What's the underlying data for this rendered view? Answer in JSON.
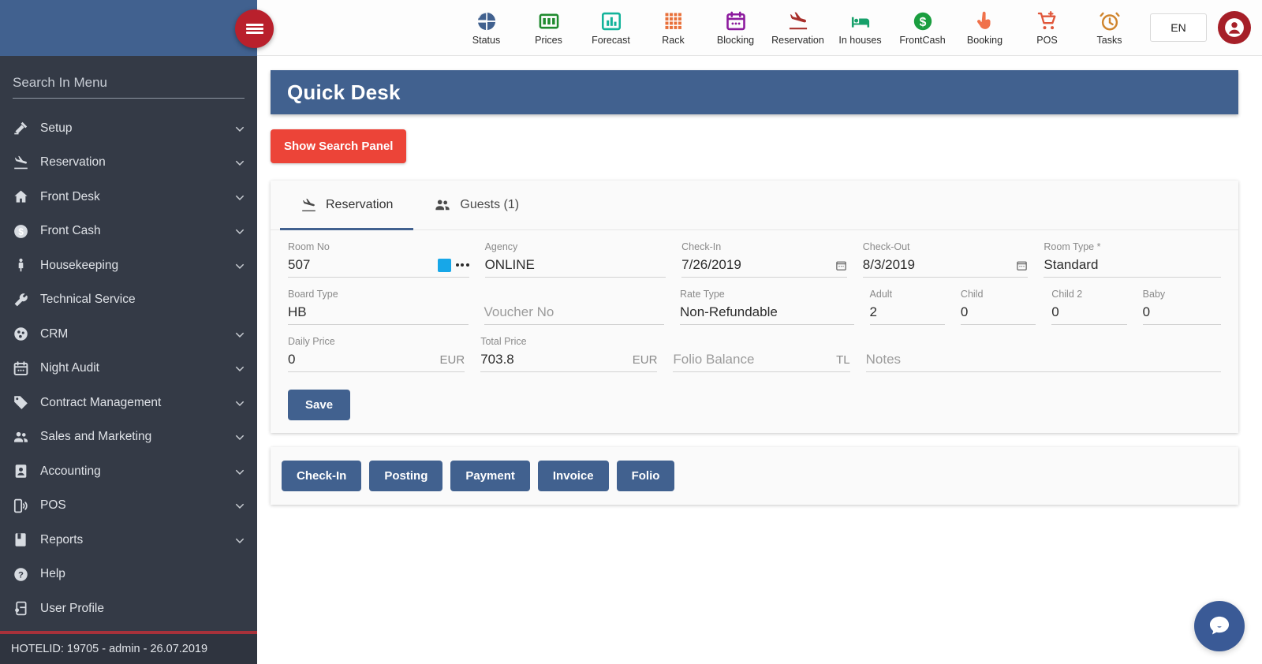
{
  "topnav": {
    "items": [
      {
        "label": "Status",
        "icon": "pie-chart-icon",
        "color": "#41618f"
      },
      {
        "label": "Prices",
        "icon": "money-bill-icon",
        "color": "#1f8a2e"
      },
      {
        "label": "Forecast",
        "icon": "bar-chart-icon",
        "color": "#13b39a"
      },
      {
        "label": "Rack",
        "icon": "grid-icon",
        "color": "#e8703a"
      },
      {
        "label": "Blocking",
        "icon": "calendar-icon",
        "color": "#8c1a9e"
      },
      {
        "label": "Reservation",
        "icon": "plane-landing-icon",
        "color": "#a8302c"
      },
      {
        "label": "In houses",
        "icon": "bed-icon",
        "color": "#16a06a"
      },
      {
        "label": "FrontCash",
        "icon": "dollar-circle-icon",
        "color": "#1a9e3f"
      },
      {
        "label": "Booking",
        "icon": "hand-click-icon",
        "color": "#f0714a"
      },
      {
        "label": "POS",
        "icon": "cart-plus-icon",
        "color": "#e0573b"
      },
      {
        "label": "Tasks",
        "icon": "alarm-clock-icon",
        "color": "#d0852e"
      }
    ],
    "language": "EN",
    "avatar_icon": "user-avatar-icon",
    "menu_toggle_icon": "hamburger-icon"
  },
  "sidebar": {
    "search_placeholder": "Search In Menu",
    "search_value": "",
    "items": [
      {
        "label": "Setup",
        "icon": "tools-icon",
        "expandable": true
      },
      {
        "label": "Reservation",
        "icon": "plane-landing-icon",
        "expandable": true
      },
      {
        "label": "Front Desk",
        "icon": "home-icon",
        "expandable": true
      },
      {
        "label": "Front Cash",
        "icon": "dollar-circle-icon",
        "expandable": true
      },
      {
        "label": "Housekeeping",
        "icon": "person-icon",
        "expandable": true
      },
      {
        "label": "Technical Service",
        "icon": "wrench-icon",
        "expandable": false
      },
      {
        "label": "CRM",
        "icon": "people-circle-icon",
        "expandable": true
      },
      {
        "label": "Night Audit",
        "icon": "calendar-icon",
        "expandable": true
      },
      {
        "label": "Contract Management",
        "icon": "tag-icon",
        "expandable": true
      },
      {
        "label": "Sales and Marketing",
        "icon": "users-icon",
        "expandable": true
      },
      {
        "label": "Accounting",
        "icon": "id-card-icon",
        "expandable": true
      },
      {
        "label": "POS",
        "icon": "mobile-signal-icon",
        "expandable": true
      },
      {
        "label": "Reports",
        "icon": "book-icon",
        "expandable": true
      },
      {
        "label": "Help",
        "icon": "question-circle-icon",
        "expandable": false
      },
      {
        "label": "User Profile",
        "icon": "profile-settings-icon",
        "expandable": false
      }
    ],
    "footer": "HOTELID: 19705 - admin - 26.07.2019"
  },
  "page": {
    "title": "Quick Desk",
    "search_panel_button": "Show Search Panel"
  },
  "tabs": [
    {
      "label": "Reservation",
      "icon": "plane-landing-icon",
      "active": true
    },
    {
      "label": "Guests (1)",
      "icon": "people-icon",
      "active": false
    }
  ],
  "form": {
    "row1": {
      "room_no": {
        "label": "Room No",
        "value": "507"
      },
      "agency": {
        "label": "Agency",
        "value": "ONLINE"
      },
      "check_in": {
        "label": "Check-In",
        "value": "7/26/2019"
      },
      "check_out": {
        "label": "Check-Out",
        "value": "8/3/2019"
      },
      "room_type": {
        "label": "Room Type *",
        "value": "Standard"
      }
    },
    "row2": {
      "board_type": {
        "label": "Board Type",
        "value": "HB"
      },
      "voucher_no": {
        "label": "",
        "value": "",
        "placeholder": "Voucher No"
      },
      "rate_type": {
        "label": "Rate Type",
        "value": "Non-Refundable"
      },
      "adult": {
        "label": "Adult",
        "value": "2"
      },
      "child": {
        "label": "Child",
        "value": "0"
      },
      "child2": {
        "label": "Child 2",
        "value": "0"
      },
      "baby": {
        "label": "Baby",
        "value": "0"
      }
    },
    "row3": {
      "daily_price": {
        "label": "Daily Price",
        "value": "0",
        "suffix": "EUR"
      },
      "total_price": {
        "label": "Total Price",
        "value": "703.8",
        "suffix": "EUR"
      },
      "folio_balance": {
        "label": "",
        "value": "",
        "placeholder": "Folio Balance",
        "suffix": "TL"
      },
      "notes": {
        "label": "",
        "value": "",
        "placeholder": "Notes"
      }
    },
    "save_label": "Save"
  },
  "actions": [
    "Check-In",
    "Posting",
    "Payment",
    "Invoice",
    "Folio"
  ],
  "chat": {
    "icon": "chat-bubble-icon"
  },
  "colors": {
    "brand_blue": "#41618f",
    "sidebar_dark": "#343a46",
    "accent_red": "#ec4438",
    "hamburger_red": "#b9202c",
    "field_blue_square": "#17a7e8"
  }
}
